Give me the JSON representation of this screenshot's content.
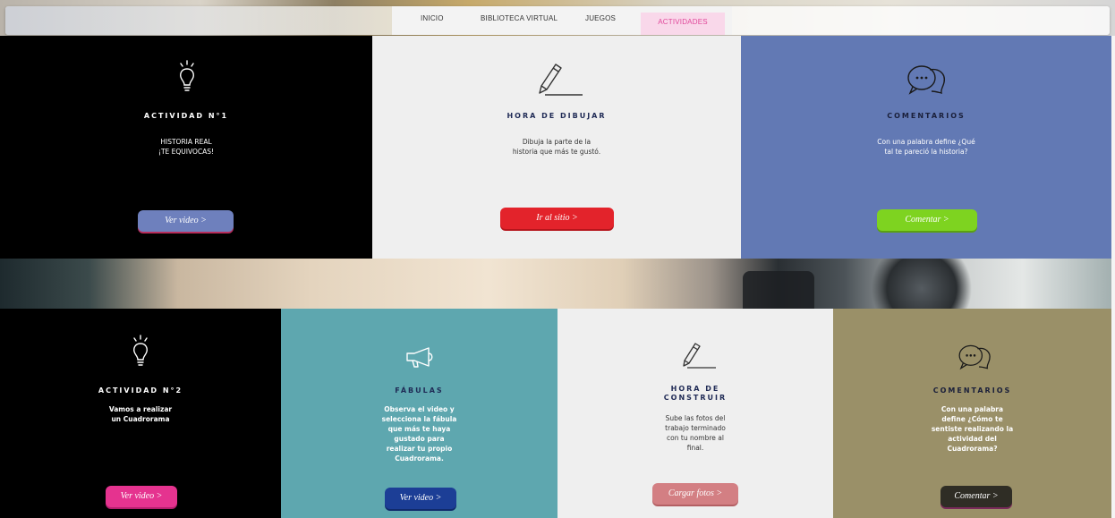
{
  "nav": {
    "items": [
      "INICIO",
      "BIBLIOTECA VIRTUAL",
      "JUEGOS",
      "ACTIVIDADES"
    ]
  },
  "row1": {
    "col1": {
      "title": "ACTIVIDAD N°1",
      "desc_line1": "HISTORIA REAL",
      "desc_line2": "¡TE EQUIVOCAS!",
      "button": "Ver video >",
      "button_color": "#6e80bd",
      "bg": "#000000"
    },
    "col2": {
      "title": "HORA DE DIBUJAR",
      "desc_line1": "Dibuja la parte de la",
      "desc_line2": "historia que más te gustó.",
      "button": "Ir al sitio >",
      "button_color": "#e3232b",
      "bg": "#efefef"
    },
    "col3": {
      "title": "COMENTARIOS",
      "desc_line1": "Con una palabra define ¿Qué",
      "desc_line2": "tal te pareció la historia?",
      "button": "Comentar >",
      "button_color": "#7ed320",
      "bg": "#6279b4"
    }
  },
  "row2": {
    "col1": {
      "title": "ACTIVIDAD N°2",
      "desc_line1": "Vamos a realizar",
      "desc_line2": "un Cuadrorama",
      "button": "Ver video >",
      "button_color": "#e5338f",
      "bg": "#000000"
    },
    "col2": {
      "title": "FÁBULAS",
      "desc_lines": [
        "Observa el video y",
        "selecciona la fábula",
        "que más te haya",
        "gustado para",
        "realizar tu propio",
        "Cuadrorama."
      ],
      "button": "Ver video >",
      "button_color": "#1c3e96",
      "bg": "#5ea7af"
    },
    "col3": {
      "title_line1": "HORA DE",
      "title_line2": "CONSTRUIR",
      "desc_lines": [
        "Sube las fotos del",
        "trabajo terminado",
        "con tu nombre al",
        "final."
      ],
      "button": "Cargar fotos >",
      "button_color": "#d37f83",
      "bg": "#efefef"
    },
    "col4": {
      "title": "COMENTARIOS",
      "desc_lines": [
        "Con una palabra",
        "define ¿Cómo te",
        "sentiste realizando la",
        "actividad del",
        "Cuadrorama?"
      ],
      "button": "Comentar >",
      "button_color": "#2f2d25",
      "bg": "#9a9068"
    }
  },
  "icons": {
    "bulb": "lightbulb-icon",
    "pencil": "pencil-icon",
    "chat": "chat-bubbles-icon",
    "megaphone": "megaphone-icon"
  }
}
